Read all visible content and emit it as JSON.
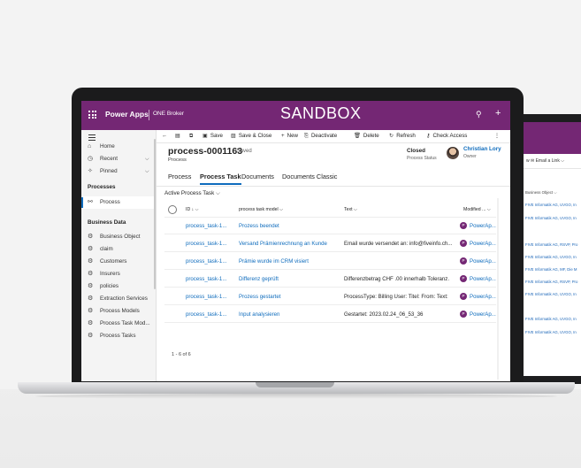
{
  "app": {
    "name": "Power Apps",
    "environment": "ONE Broker",
    "banner": "SANDBOX"
  },
  "sidebar": {
    "items": [
      {
        "icon": "home-icon",
        "glyph": "⌂",
        "label": "Home"
      },
      {
        "icon": "clock-icon",
        "glyph": "◷",
        "label": "Recent",
        "chevron": "⌵"
      },
      {
        "icon": "pin-icon",
        "glyph": "✧",
        "label": "Pinned",
        "chevron": "⌵"
      }
    ],
    "section_processes": "Processes",
    "process_item": {
      "glyph": "⚯",
      "label": "Process"
    },
    "section_business": "Business Data",
    "business_items": [
      {
        "glyph": "⚙",
        "label": "Business Object"
      },
      {
        "glyph": "⚙",
        "label": "claim"
      },
      {
        "glyph": "⚙",
        "label": "Customers"
      },
      {
        "glyph": "⚙",
        "label": "Insurers"
      },
      {
        "glyph": "⚙",
        "label": "policies"
      },
      {
        "glyph": "⚙",
        "label": "Extraction Services"
      },
      {
        "glyph": "⚙",
        "label": "Process Models"
      },
      {
        "glyph": "⚙",
        "label": "Process Task Mod..."
      },
      {
        "glyph": "⚙",
        "label": "Process Tasks"
      }
    ]
  },
  "commands": {
    "back": "←",
    "save": "Save",
    "save_close": "Save & Close",
    "new": "New",
    "deactivate": "Deactivate",
    "delete": "Delete",
    "refresh": "Refresh",
    "check_access": "Check Access",
    "more": "⋮"
  },
  "record": {
    "title": "process-0001163",
    "saved": "- Saved",
    "entity": "Process",
    "status_value": "Closed",
    "status_label": "Process Status",
    "owner_name": "Christian Lory",
    "owner_label": "Owner"
  },
  "tabs": [
    "Process",
    "Process Task",
    "Documents",
    "Documents Classic"
  ],
  "view": {
    "name": "Active Process Task ⌵"
  },
  "grid": {
    "columns": [
      "ID ↓ ⌵",
      "process task model ⌵",
      "Text ⌵",
      "Modified ... ⌵"
    ],
    "rows": [
      {
        "id": "process_task-1...",
        "model": "Prozess beendet",
        "text": "",
        "modified": "PowerAp..."
      },
      {
        "id": "process_task-1...",
        "model": "Versand Prämienrechnung an Kunde",
        "text": "Email wurde versendet an: info@fiveinfo.ch...",
        "modified": "PowerAp..."
      },
      {
        "id": "process_task-1...",
        "model": "Prämie wurde im CRM visiert",
        "text": "",
        "modified": "PowerAp..."
      },
      {
        "id": "process_task-1...",
        "model": "Differenz geprüft",
        "text": "Differenzbetrag CHF .00 innerhalb Toleranz.",
        "modified": "PowerAp..."
      },
      {
        "id": "process_task-1...",
        "model": "Prozess gestartet",
        "text": "ProcessType: Billing User:  Titel:  From:  Text:",
        "modified": "PowerAp..."
      },
      {
        "id": "process_task-1...",
        "model": "Input analysieren",
        "text": "Gestartet: 2023.02.24_06_53_36",
        "modified": "PowerAp..."
      }
    ],
    "avatar_letter": "P",
    "count": "1 - 6 of 6"
  },
  "second_device": {
    "command_text": "w  ✉ Email a Link  ⌵",
    "column_header": "Business Object ⌵",
    "rows": [
      "FIVE Informatik AG, UVGO, In",
      "FIVE Informatik AG, UVGO, In",
      "FIVE Informatik AG, RSVP, Pro",
      "FIVE Informatik AG, UVGO, In",
      "FIVE Informatik AG, MF, Die M",
      "FIVE Informatik AG, RSVP, Pro",
      "FIVE Informatik AG, UVGO, In",
      "FIVE Informatik AG, UVGO, In",
      "FIVE Informatik AG, UVGO, In"
    ]
  },
  "colors": {
    "brand": "#742774",
    "accent": "#0f6cbd"
  }
}
